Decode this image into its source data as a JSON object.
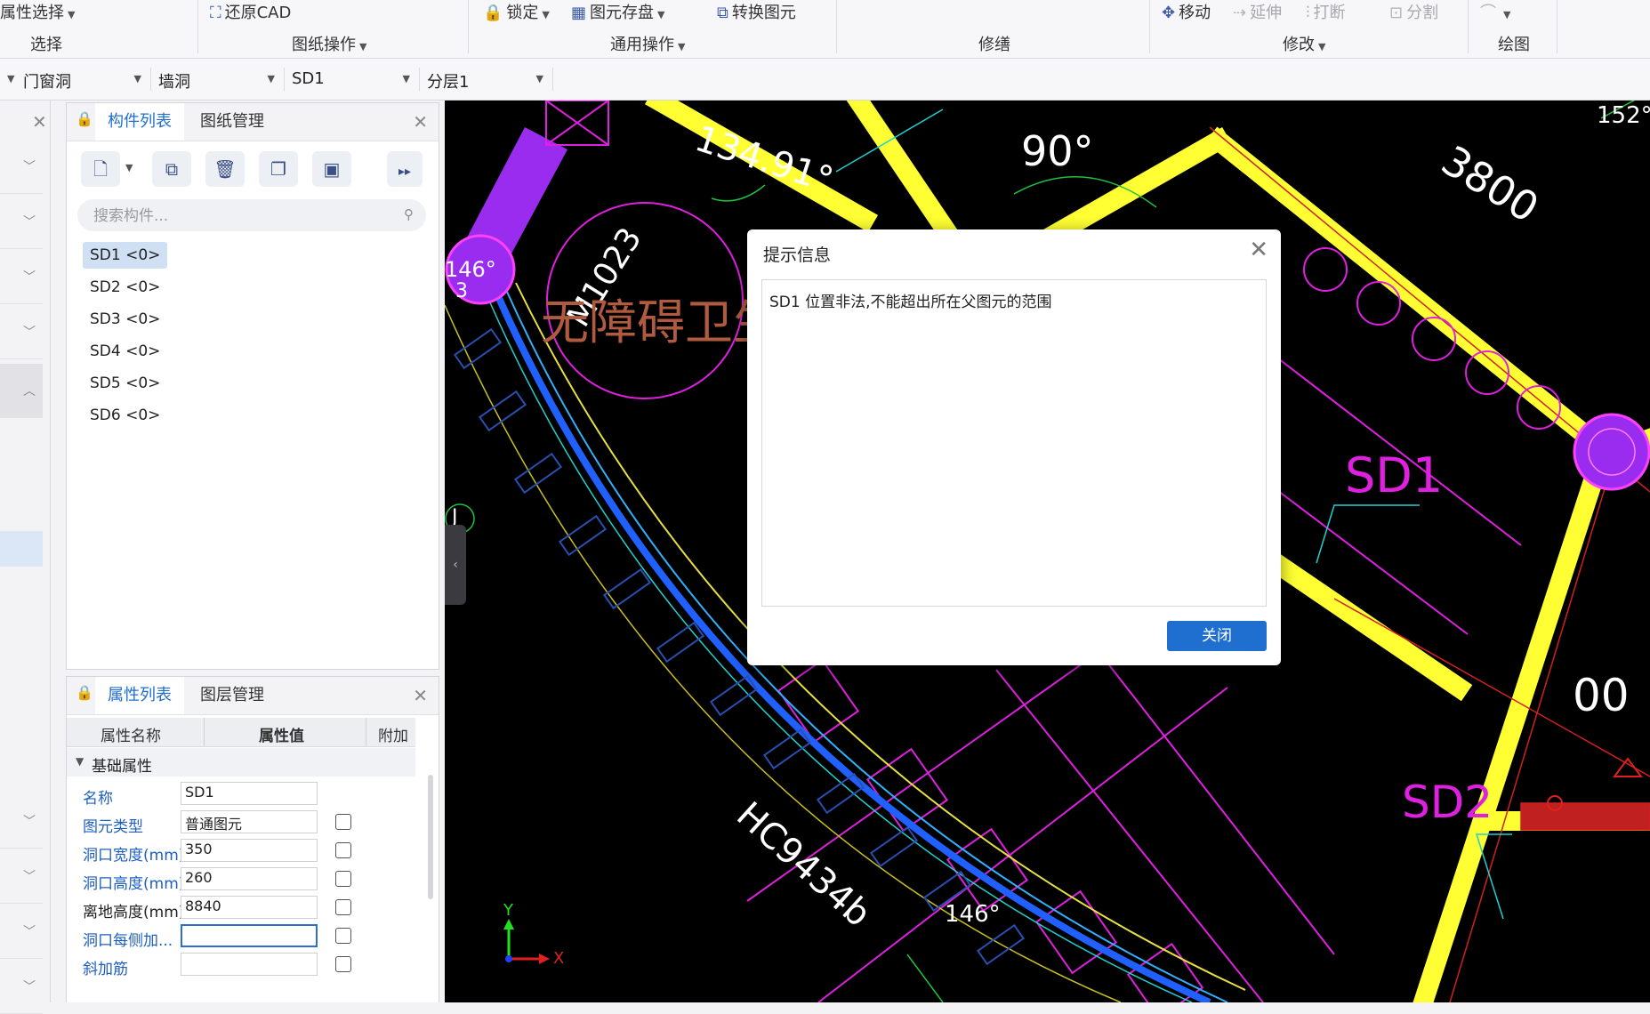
{
  "ribbon": {
    "attr_select": "属性选择",
    "restore_cad": "还原CAD",
    "lock": "锁定",
    "save_elements": "图元存盘",
    "convert_elements": "转换图元",
    "move": "移动",
    "extend": "延伸",
    "break": "打断",
    "split": "分割",
    "groups": {
      "select": "选择",
      "drawing_ops": "图纸操作",
      "common_ops": "通用操作",
      "trim": "修缮",
      "modify": "修改",
      "draw": "绘图"
    }
  },
  "selectors": [
    {
      "value": "门窗洞"
    },
    {
      "value": "墙洞"
    },
    {
      "value": "SD1"
    },
    {
      "value": "分层1"
    }
  ],
  "component_panel": {
    "tab_components": "构件列表",
    "tab_drawings": "图纸管理",
    "search_placeholder": "搜索构件...",
    "items": [
      "SD1 <0>",
      "SD2 <0>",
      "SD3 <0>",
      "SD4 <0>",
      "SD5 <0>",
      "SD6 <0>"
    ]
  },
  "property_panel": {
    "tab_properties": "属性列表",
    "tab_layers": "图层管理",
    "col_name": "属性名称",
    "col_value": "属性值",
    "col_extra": "附加",
    "section": "基础属性",
    "rows": [
      {
        "name": "名称",
        "value": "SD1"
      },
      {
        "name": "图元类型",
        "value": "普通图元"
      },
      {
        "name": "洞口宽度(mm)",
        "value": "350"
      },
      {
        "name": "洞口高度(mm)",
        "value": "260"
      },
      {
        "name": "离地高度(mm)",
        "value": "8840"
      },
      {
        "name": "洞口每侧加...",
        "value": ""
      },
      {
        "name": "斜加筋",
        "value": ""
      }
    ]
  },
  "canvas": {
    "labels": {
      "angle_152": "152°",
      "dim_3800": "3800",
      "angle_90": "90°",
      "angle_13491": "134.91°",
      "tag_m1023": "M1023",
      "angle_146_top": "146°",
      "num_3": "3",
      "room_name": "无障碍卫生间",
      "tag_sd1": "SD1",
      "tag_sd2": "SD2",
      "tag_hc": "HC9434b",
      "angle_146_bottom": "146°",
      "axis_j": "J",
      "dim_00": "00",
      "axis_y": "Y",
      "axis_x": "X"
    }
  },
  "dialog": {
    "title": "提示信息",
    "message": "SD1 位置非法,不能超出所在父图元的范围",
    "close_button": "关闭"
  },
  "colors": {
    "accent": "#1f6fd1",
    "canvas_bg": "#000000",
    "wall_yellow": "#ffff33",
    "cad_magenta": "#e020e0",
    "cad_blue": "#2060ff",
    "cad_cyan": "#20d0d0"
  }
}
